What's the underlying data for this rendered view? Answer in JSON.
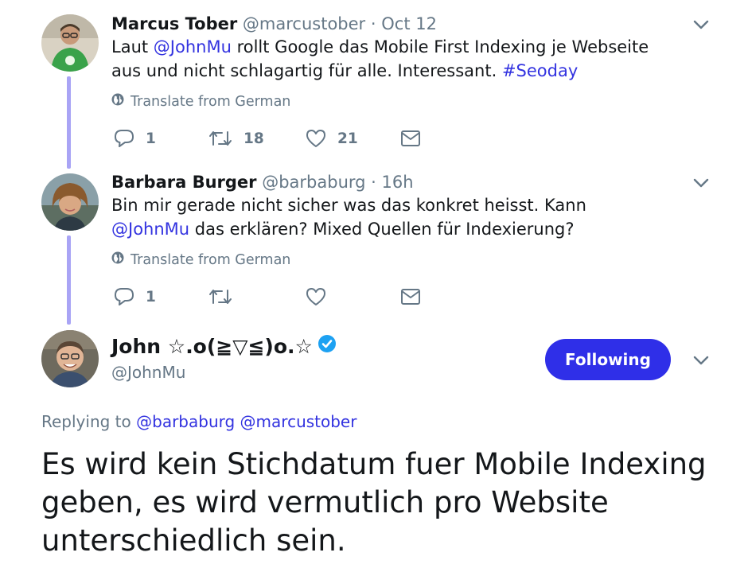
{
  "tweets": [
    {
      "name": "Marcus Tober",
      "handle": "@marcustober",
      "separator": "·",
      "time": "Oct 12",
      "text_parts": {
        "a": "Laut ",
        "mention": "@JohnMu",
        "b": " rollt Google das Mobile First Indexing je Webseite aus und nicht schlagartig für alle. Interessant. ",
        "hashtag": "#Seoday"
      },
      "translate": "Translate from German",
      "replies": "1",
      "retweets": "18",
      "likes": "21"
    },
    {
      "name": "Barbara Burger",
      "handle": "@barbaburg",
      "separator": "·",
      "time": "16h",
      "text_parts": {
        "a": "Bin mir gerade nicht sicher was das konkret heisst. Kann ",
        "mention": "@JohnMu",
        "b": " das erklären? Mixed Quellen für Indexierung?"
      },
      "translate": "Translate from German",
      "replies": "1"
    }
  ],
  "main": {
    "name": "John ☆.o(≧▽≦)o.☆",
    "handle": "@JohnMu",
    "follow_label": "Following",
    "replying_to_label": "Replying to",
    "reply_mentions": [
      "@barbaburg",
      "@marcustober"
    ],
    "text": "Es wird kein Stichdatum fuer Mobile Indexing geben, es wird vermutlich pro Website unterschiedlich sein."
  },
  "colors": {
    "link": "#3333e0",
    "follow_button": "#2f2fe8",
    "thread_line": "#a9a4f5",
    "verified": "#1da1f2",
    "muted": "#657786"
  },
  "icons": [
    "reply-icon",
    "retweet-icon",
    "like-icon",
    "message-icon",
    "globe-icon",
    "chevron-down-icon",
    "verified-badge-icon"
  ]
}
